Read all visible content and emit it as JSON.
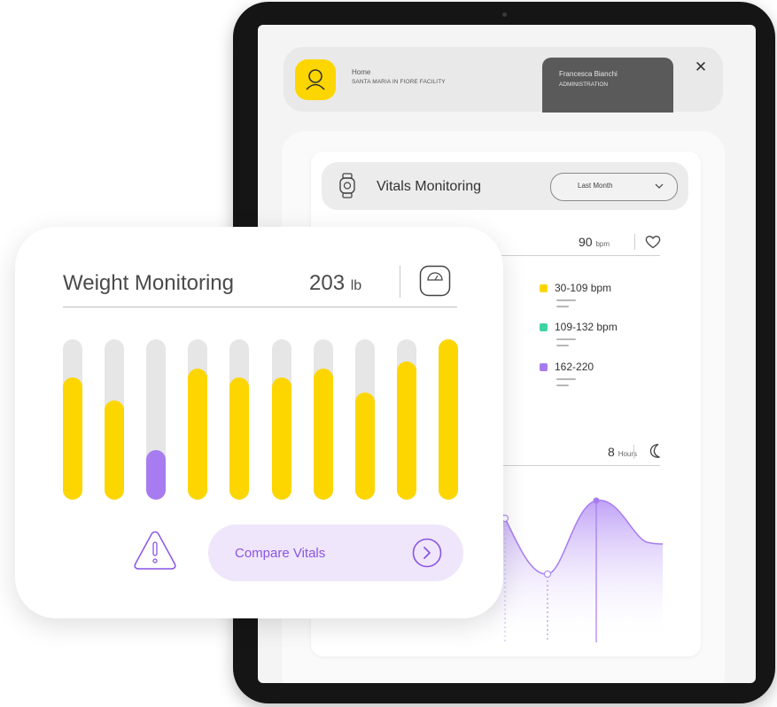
{
  "colors": {
    "accent_yellow": "#fdd600",
    "accent_purple": "#a77cf0",
    "purple_text": "#8a55e3",
    "legend_teal": "#3fd2a4",
    "dark_card": "#5a5a5a"
  },
  "topbar": {
    "home_label": "Home",
    "facility": "SANTA MARIA IN FIORE FACILITY",
    "user_name": "Francesca Bianchi",
    "user_role": "ADMINISTRATION",
    "avatar_icon": "user-icon",
    "close_icon": "close-icon",
    "close_label": "✕"
  },
  "vitals": {
    "title": "Vitals Monitoring",
    "icon": "smartwatch-icon",
    "period": "Last Month",
    "heart_rate": {
      "value": "90",
      "unit": "bpm",
      "icon": "heart-icon"
    },
    "legend": [
      {
        "label": "30-109 bpm",
        "color": "#fdd600"
      },
      {
        "label": "109-132 bpm",
        "color": "#3fd2a4"
      },
      {
        "label": "162-220",
        "color": "#a77cf0"
      }
    ],
    "sleep": {
      "value": "8",
      "unit": "Hours",
      "icon": "moon-icon"
    }
  },
  "weight": {
    "title": "Weight Monitoring",
    "value": "203",
    "unit": "lb",
    "icon": "scale-icon",
    "bar_fill_levels": [
      0.76,
      0.62,
      0.31,
      0.82,
      0.76,
      0.76,
      0.82,
      0.67,
      0.86,
      1.0
    ],
    "bar_colors": [
      "yellow",
      "yellow",
      "purple",
      "yellow",
      "yellow",
      "yellow",
      "yellow",
      "yellow",
      "yellow",
      "yellow"
    ],
    "warning_icon": "warning-triangle-icon",
    "compare_label": "Compare Vitals",
    "compare_icon": "arrow-right-circle-icon"
  }
}
